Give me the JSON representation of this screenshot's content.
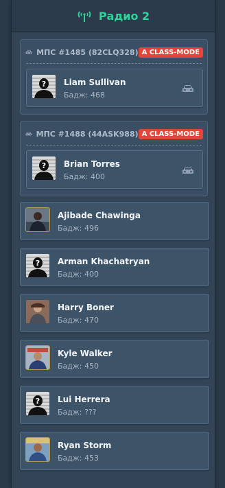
{
  "header": {
    "title": "Радио 2",
    "icon": "antenna-icon"
  },
  "colors": {
    "accent": "#2ed39a",
    "badge": "#e2453a"
  },
  "groups": [
    {
      "label": "МПС #1485 (82CLQ328)",
      "badge": "A CLASS-MODE",
      "member": {
        "name": "Liam Sullivan",
        "badge_label": "Бадж: 468"
      }
    },
    {
      "label": "МПС #1488 (44ASK988)",
      "badge": "A CLASS-MODE",
      "member": {
        "name": "Brian Torres",
        "badge_label": "Бадж: 400"
      }
    }
  ],
  "members": [
    {
      "name": "Ajibade Chawinga",
      "badge_label": "Бадж: 496"
    },
    {
      "name": "Arman Khachatryan",
      "badge_label": "Бадж: 400"
    },
    {
      "name": "Harry Boner",
      "badge_label": "Бадж: 470"
    },
    {
      "name": "Kyle Walker",
      "badge_label": "Бадж: 450"
    },
    {
      "name": "Lui Herrera",
      "badge_label": "Бадж: ???"
    },
    {
      "name": "Ryan Storm",
      "badge_label": "Бадж: 453"
    }
  ]
}
